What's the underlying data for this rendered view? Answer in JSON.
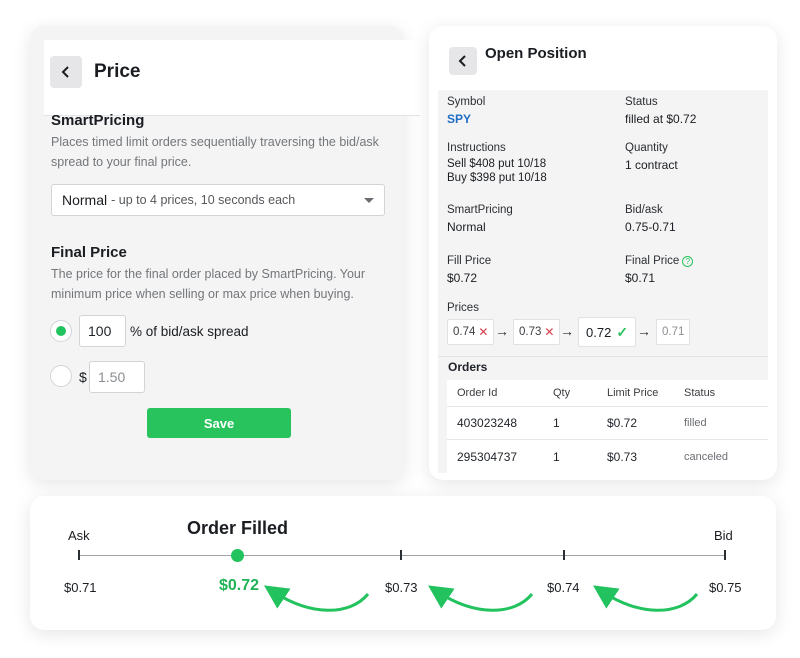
{
  "price_panel": {
    "title": "Price",
    "smart_pricing": {
      "heading": "SmartPricing",
      "description": "Places timed limit orders sequentially traversing the bid/ask spread to your final price.",
      "select_main": "Normal",
      "select_sub": "- up to 4 prices, 10 seconds each"
    },
    "final_price": {
      "heading": "Final Price",
      "description": "The price for the final order placed by SmartPricing. Your minimum price when selling or max price when buying.",
      "spread_value": "100",
      "spread_suffix": "% of bid/ask spread",
      "dollar_sign": "$",
      "dollar_placeholder": "1.50"
    },
    "save_label": "Save",
    "accent": "#28c35c"
  },
  "position_panel": {
    "title": "Open Position",
    "symbol_label": "Symbol",
    "symbol_value": "SPY",
    "status_label": "Status",
    "status_value": "filled at $0.72",
    "instructions_label": "Instructions",
    "instructions_line1": "Sell $408 put 10/18",
    "instructions_line2": "Buy $398 put 10/18",
    "quantity_label": "Quantity",
    "quantity_value": "1 contract",
    "smartpricing_label": "SmartPricing",
    "smartpricing_value": "Normal",
    "bidask_label": "Bid/ask",
    "bidask_value": "0.75-0.71",
    "fill_price_label": "Fill Price",
    "fill_price_value": "$0.72",
    "final_price_label": "Final Price",
    "final_price_value": "$0.71",
    "prices_label": "Prices",
    "prices": [
      {
        "value": "0.74",
        "state": "rejected"
      },
      {
        "value": "0.73",
        "state": "rejected"
      },
      {
        "value": "0.72",
        "state": "filled"
      },
      {
        "value": "0.71",
        "state": "pending"
      }
    ],
    "arrow": "→",
    "orders": {
      "title": "Orders",
      "columns": [
        "Order Id",
        "Qty",
        "Limit Price",
        "Status"
      ],
      "rows": [
        [
          "403023248",
          "1",
          "$0.72",
          "filled"
        ],
        [
          "295304737",
          "1",
          "$0.73",
          "canceled"
        ]
      ]
    },
    "link_color": "#1f6ec4"
  },
  "timeline": {
    "ask_label": "Ask",
    "bid_label": "Bid",
    "filled_label": "Order Filled",
    "prices": [
      "$0.71",
      "$0.72",
      "$0.73",
      "$0.74",
      "$0.75"
    ]
  }
}
